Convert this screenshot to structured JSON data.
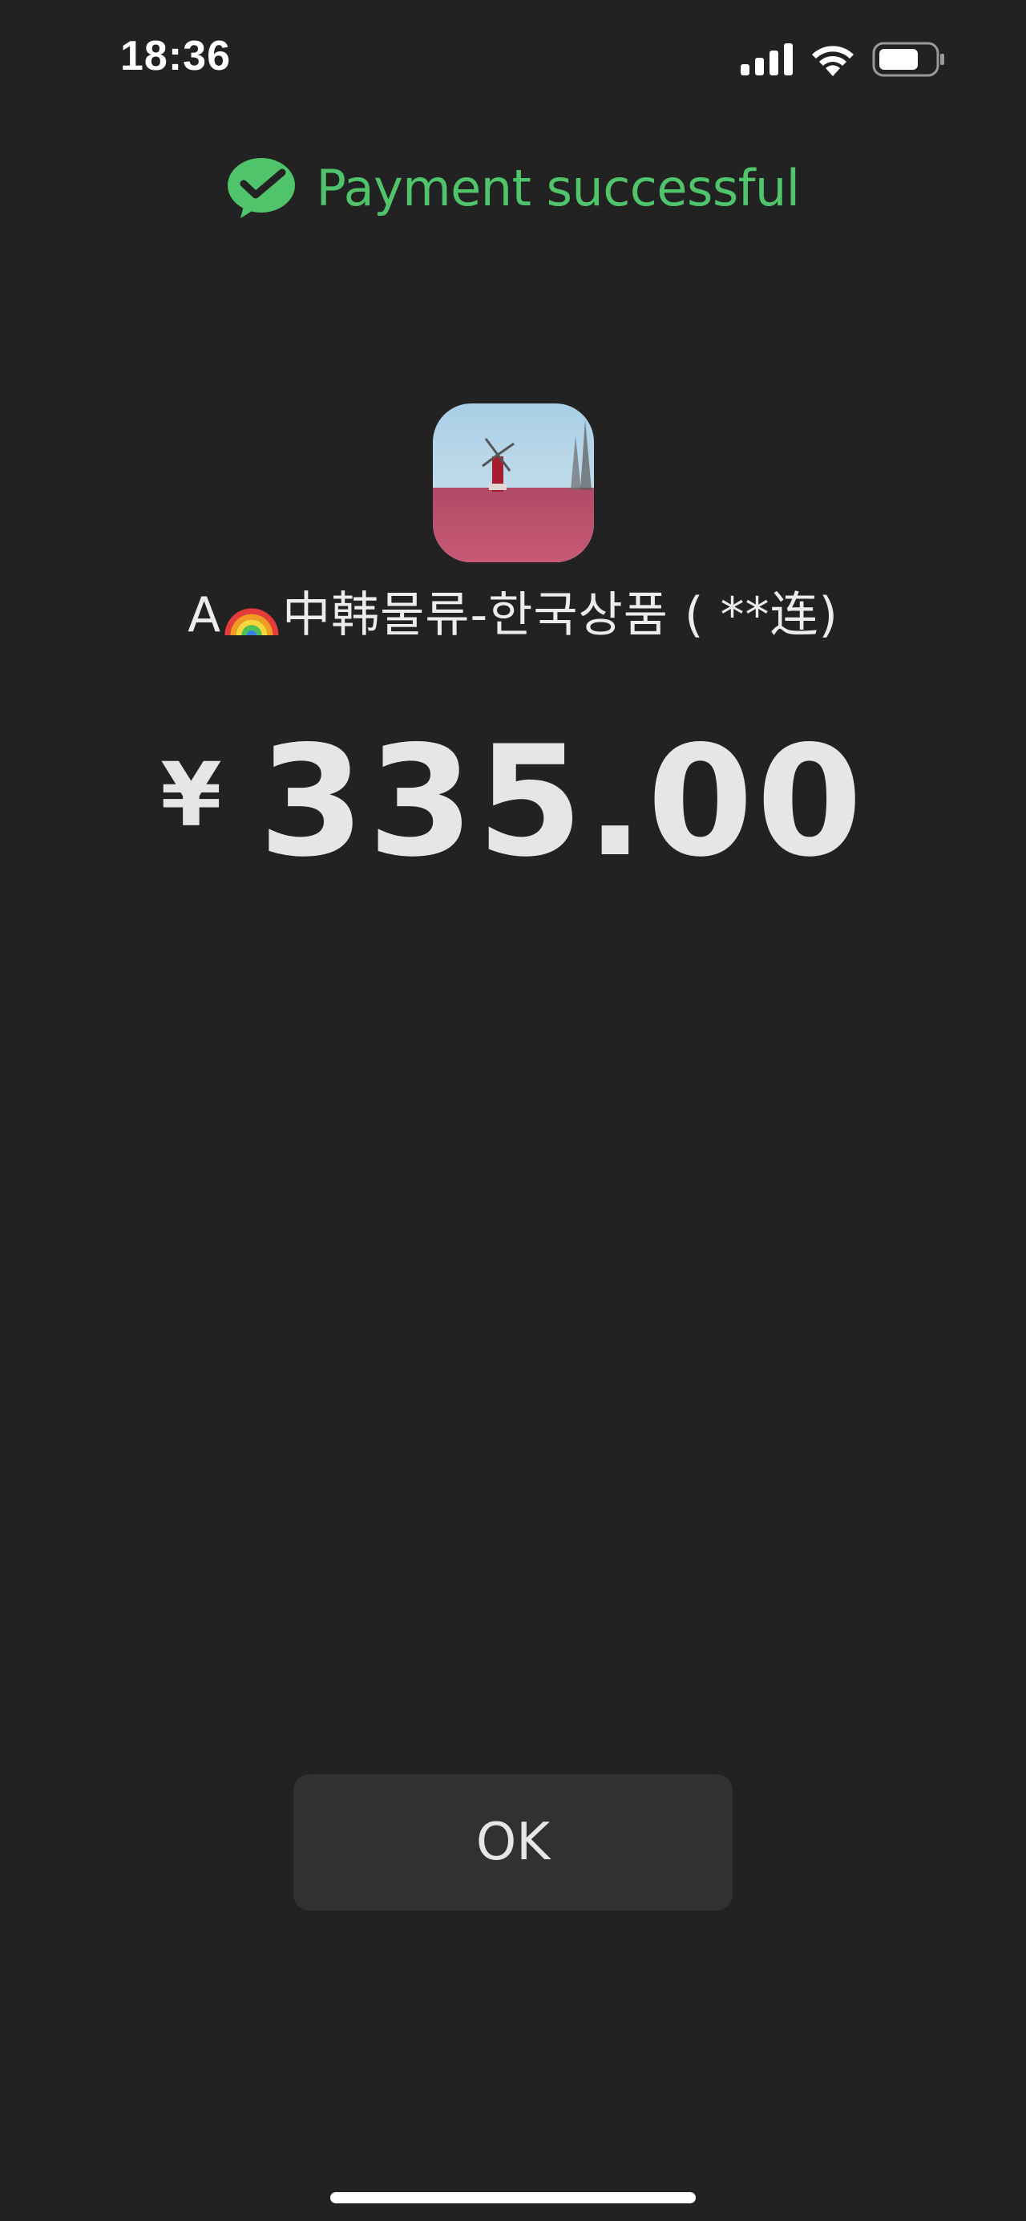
{
  "status_bar": {
    "time": "18:36",
    "icons": [
      "cellular-signal-icon",
      "wifi-icon",
      "battery-icon"
    ]
  },
  "header": {
    "icon": "wechat-pay-check-icon",
    "title": "Payment successful",
    "accent_color": "#4fc46b"
  },
  "merchant": {
    "avatar": "windmill-field-avatar",
    "name_prefix": "A",
    "name_emoji_icon": "rainbow-icon",
    "name_suffix": "中韩물류-한국상품 ( **连)"
  },
  "amount": {
    "currency_symbol": "¥",
    "value": "335.00"
  },
  "actions": {
    "ok_label": "OK"
  },
  "colors": {
    "background": "#222222",
    "button_background": "#313131",
    "text": "#e6e6e6"
  }
}
